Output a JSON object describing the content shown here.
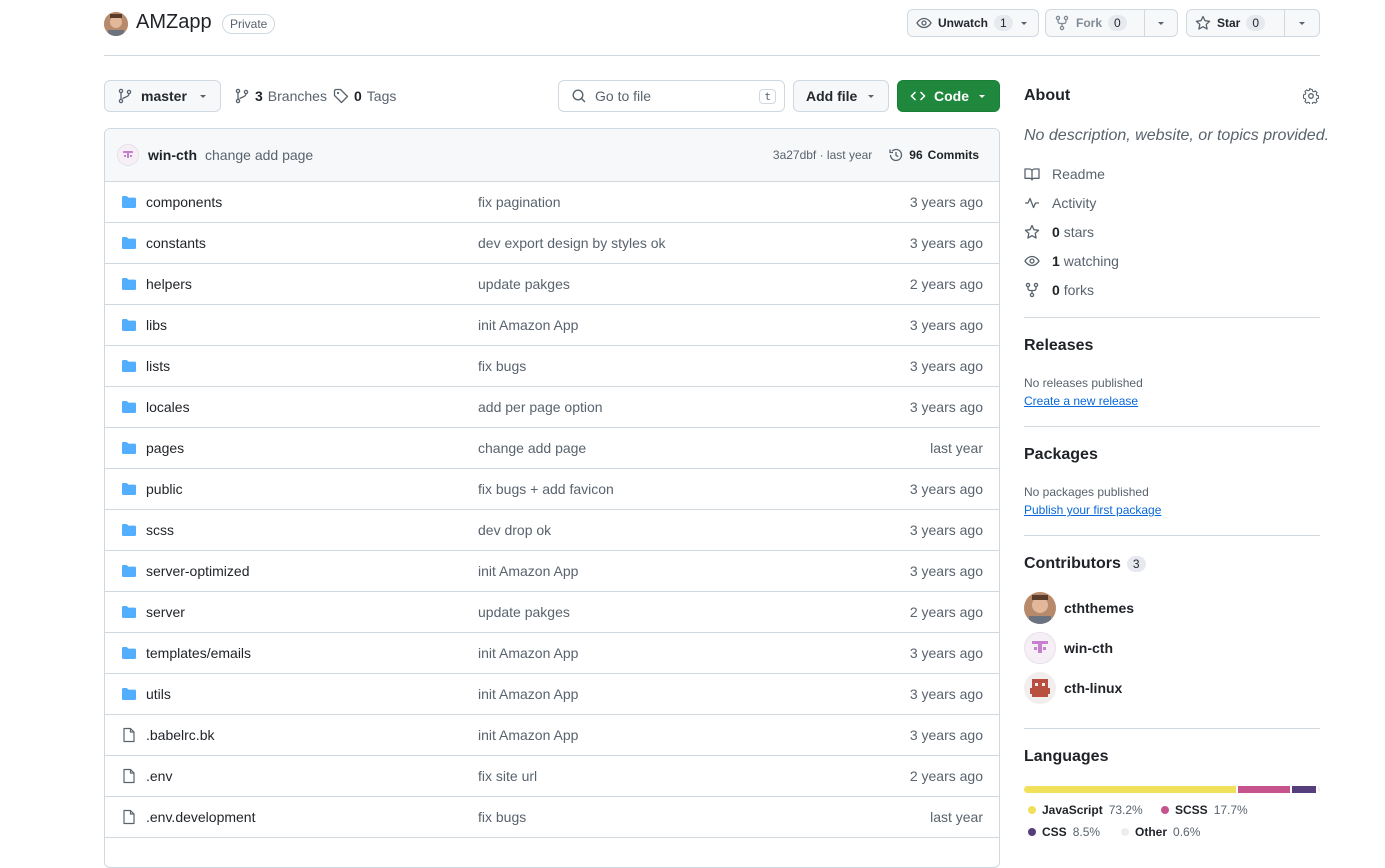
{
  "header": {
    "repo_name": "AMZapp",
    "visibility": "Private",
    "watch": {
      "label": "Unwatch",
      "count": "1"
    },
    "fork": {
      "label": "Fork",
      "count": "0"
    },
    "star": {
      "label": "Star",
      "count": "0"
    }
  },
  "toolbar": {
    "branch": "master",
    "branches_count": "3",
    "branches_label": "Branches",
    "tags_count": "0",
    "tags_label": "Tags",
    "goto_placeholder": "Go to file",
    "goto_shortcut": "t",
    "add_file": "Add file",
    "code": "Code"
  },
  "commit": {
    "author": "win-cth",
    "message": "change add page",
    "meta": "3a27dbf · last year",
    "commits_count": "96",
    "commits_label": "Commits"
  },
  "files": [
    {
      "type": "folder",
      "name": "components",
      "message": "fix pagination",
      "date": "3 years ago"
    },
    {
      "type": "folder",
      "name": "constants",
      "message": "dev export design by styles ok",
      "date": "3 years ago"
    },
    {
      "type": "folder",
      "name": "helpers",
      "message": "update pakges",
      "date": "2 years ago"
    },
    {
      "type": "folder",
      "name": "libs",
      "message": "init Amazon App",
      "date": "3 years ago"
    },
    {
      "type": "folder",
      "name": "lists",
      "message": "fix bugs",
      "date": "3 years ago"
    },
    {
      "type": "folder",
      "name": "locales",
      "message": "add per page option",
      "date": "3 years ago"
    },
    {
      "type": "folder",
      "name": "pages",
      "message": "change add page",
      "date": "last year"
    },
    {
      "type": "folder",
      "name": "public",
      "message": "fix bugs + add favicon",
      "date": "3 years ago"
    },
    {
      "type": "folder",
      "name": "scss",
      "message": "dev drop ok",
      "date": "3 years ago"
    },
    {
      "type": "folder",
      "name": "server-optimized",
      "message": "init Amazon App",
      "date": "3 years ago"
    },
    {
      "type": "folder",
      "name": "server",
      "message": "update pakges",
      "date": "2 years ago"
    },
    {
      "type": "folder",
      "name": "templates/emails",
      "message": "init Amazon App",
      "date": "3 years ago"
    },
    {
      "type": "folder",
      "name": "utils",
      "message": "init Amazon App",
      "date": "3 years ago"
    },
    {
      "type": "file",
      "name": ".babelrc.bk",
      "message": "init Amazon App",
      "date": "3 years ago"
    },
    {
      "type": "file",
      "name": ".env",
      "message": "fix site url",
      "date": "2 years ago"
    },
    {
      "type": "file",
      "name": ".env.development",
      "message": "fix bugs",
      "date": "last year"
    }
  ],
  "about": {
    "title": "About",
    "description": "No description, website, or topics provided.",
    "readme": "Readme",
    "activity": "Activity",
    "stars_count": "0",
    "stars_label": "stars",
    "watching_count": "1",
    "watching_label": "watching",
    "forks_count": "0",
    "forks_label": "forks"
  },
  "releases": {
    "title": "Releases",
    "empty": "No releases published",
    "link": "Create a new release"
  },
  "packages": {
    "title": "Packages",
    "empty": "No packages published",
    "link": "Publish your first package"
  },
  "contributors": {
    "title": "Contributors",
    "count": "3",
    "list": [
      {
        "name": "cththemes"
      },
      {
        "name": "win-cth"
      },
      {
        "name": "cth-linux"
      }
    ]
  },
  "languages": {
    "title": "Languages",
    "items": [
      {
        "name": "JavaScript",
        "percent": "73.2%",
        "value": 73.2,
        "color": "#f1e05a"
      },
      {
        "name": "SCSS",
        "percent": "17.7%",
        "value": 17.7,
        "color": "#c6538c"
      },
      {
        "name": "CSS",
        "percent": "8.5%",
        "value": 8.5,
        "color": "#563d7c"
      },
      {
        "name": "Other",
        "percent": "0.6%",
        "value": 0.6,
        "color": "#ededed"
      }
    ]
  },
  "colors": {
    "accent": "#1f883d",
    "link": "#0969da",
    "folder": "#54aeff"
  }
}
